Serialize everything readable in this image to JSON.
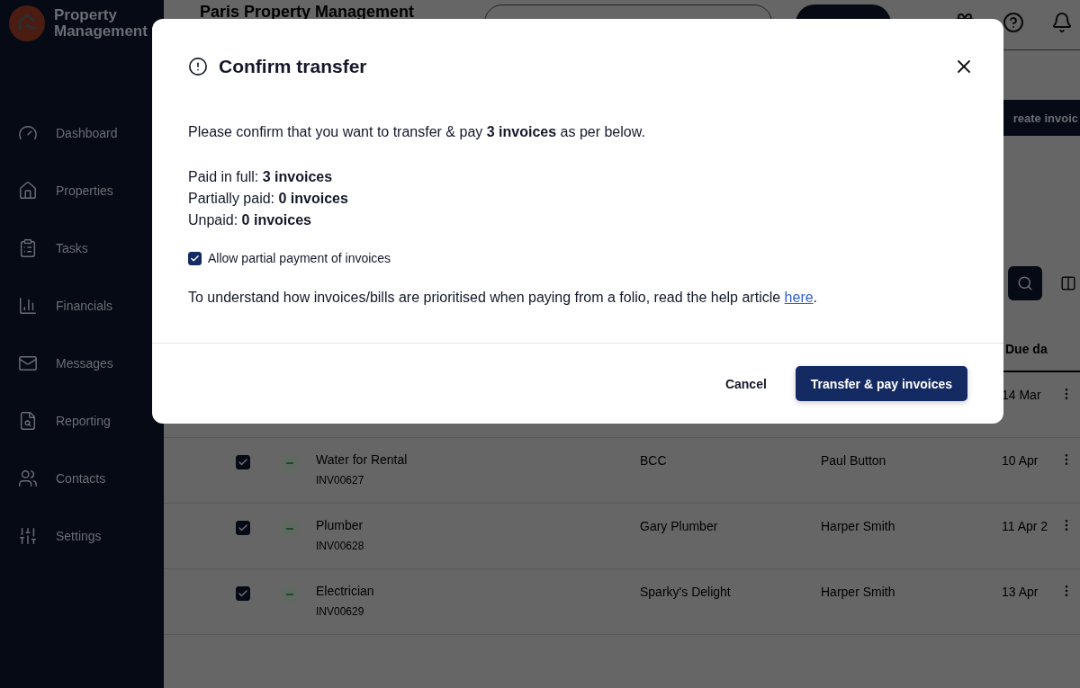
{
  "sidebar": {
    "brand": "Property Management",
    "items": [
      {
        "label": "Dashboard"
      },
      {
        "label": "Properties"
      },
      {
        "label": "Tasks"
      },
      {
        "label": "Financials"
      },
      {
        "label": "Messages"
      },
      {
        "label": "Reporting"
      },
      {
        "label": "Contacts"
      },
      {
        "label": "Settings"
      }
    ]
  },
  "header": {
    "title": "Paris Property Management"
  },
  "toolbar": {
    "create_button": "reate invoic"
  },
  "table": {
    "column_header": "Due da",
    "rows": [
      {
        "date": "14 Mar"
      },
      {
        "checked": true,
        "title": "Water for Rental",
        "number": "INV00627",
        "column_3": "BCC",
        "column_4": "Paul Button",
        "date": "10 Apr"
      },
      {
        "checked": true,
        "title": "Plumber",
        "number": "INV00628",
        "column_3": "Gary Plumber",
        "column_4": "Harper Smith",
        "date": "11 Apr 2"
      },
      {
        "checked": true,
        "title": "Electrician",
        "number": "INV00629",
        "column_3": "Sparky's Delight",
        "column_4": "Harper Smith",
        "date": "13 Apr"
      }
    ]
  },
  "modal": {
    "title": "Confirm transfer",
    "message": "Please confirm that you want to transfer & pay **3 invoices** as per below.",
    "summary": [
      "Paid in full: **3 invoices**",
      "Partially paid: **0 invoices**",
      "Unpaid: **0 invoices**"
    ],
    "checkbox": {
      "label": "Allow partial payment of invoices",
      "checked": true
    },
    "help": {
      "text": "To understand how invoices/bills are prioritised when paying from a folio, read the help article ",
      "link": "here",
      "end": "."
    },
    "buttons": {
      "cancel": "Cancel",
      "confirm": "Transfer & pay invoices"
    }
  }
}
